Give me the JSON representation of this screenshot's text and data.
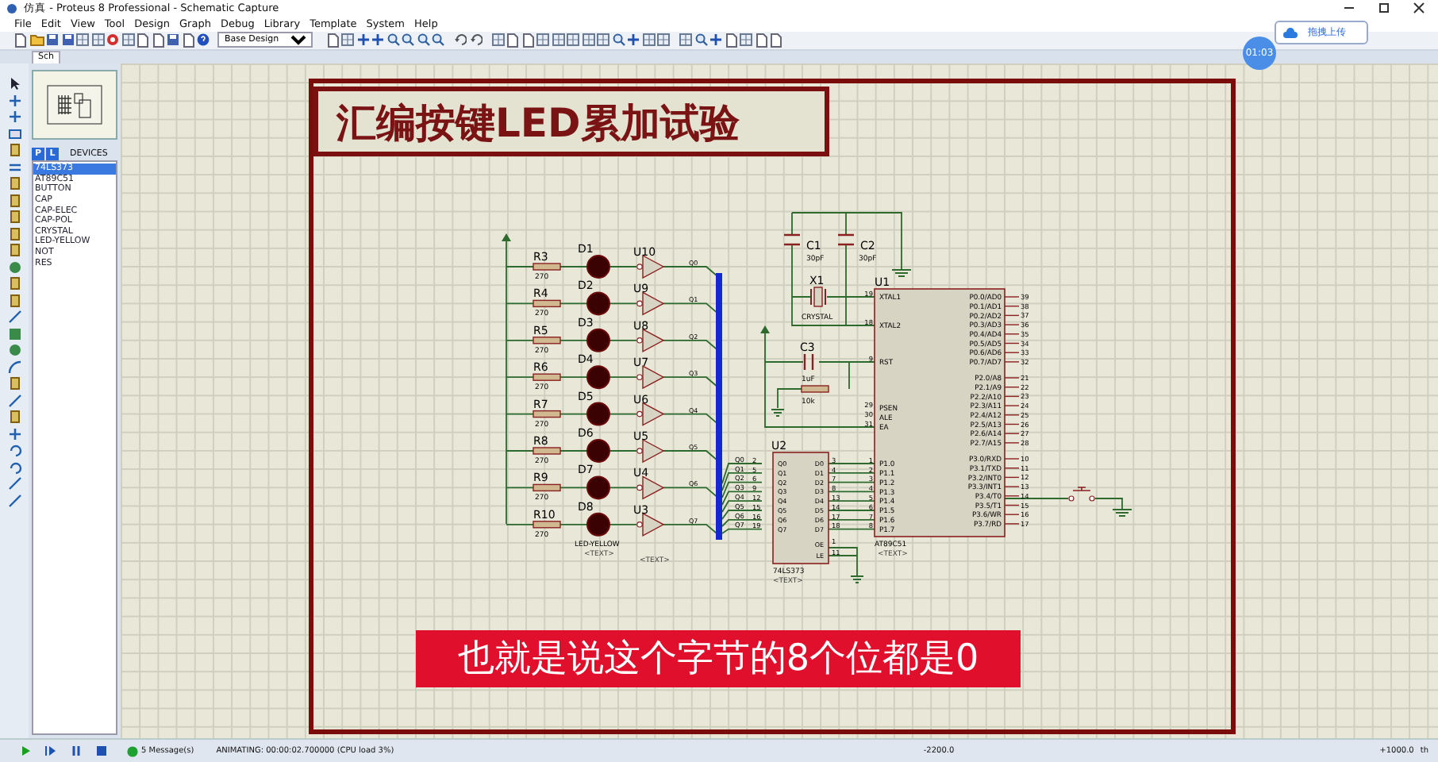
{
  "window": {
    "title": "仿真 - Proteus 8 Professional - Schematic Capture"
  },
  "menu": [
    "File",
    "Edit",
    "View",
    "Tool",
    "Design",
    "Graph",
    "Debug",
    "Library",
    "Template",
    "System",
    "Help"
  ],
  "toolbar": {
    "variant": "Base Design"
  },
  "tabs": [
    {
      "label": "Sch",
      "selected": true
    }
  ],
  "devices_panel": {
    "pick_button": "P",
    "library_button": "L",
    "title": "DEVICES"
  },
  "devices": [
    {
      "label": "74LS373",
      "selected": true
    },
    {
      "label": "AT89C51",
      "selected": false
    },
    {
      "label": "BUTTON",
      "selected": false
    },
    {
      "label": "CAP",
      "selected": false
    },
    {
      "label": "CAP-ELEC",
      "selected": false
    },
    {
      "label": "CAP-POL",
      "selected": false
    },
    {
      "label": "CRYSTAL",
      "selected": false
    },
    {
      "label": "LED-YELLOW",
      "selected": false
    },
    {
      "label": "NOT",
      "selected": false
    },
    {
      "label": "RES",
      "selected": false
    }
  ],
  "schematic": {
    "title": "汇编按键LED累加试验",
    "rows": [
      {
        "resistor": "R3",
        "value": "270",
        "led": "D1",
        "gate": "U10",
        "net": "Q0"
      },
      {
        "resistor": "R4",
        "value": "270",
        "led": "D2",
        "gate": "U9",
        "net": "Q1"
      },
      {
        "resistor": "R5",
        "value": "270",
        "led": "D3",
        "gate": "U8",
        "net": "Q2"
      },
      {
        "resistor": "R6",
        "value": "270",
        "led": "D4",
        "gate": "U7",
        "net": "Q3"
      },
      {
        "resistor": "R7",
        "value": "270",
        "led": "D5",
        "gate": "U6",
        "net": "Q4"
      },
      {
        "resistor": "R8",
        "value": "270",
        "led": "D6",
        "gate": "U5",
        "net": "Q5"
      },
      {
        "resistor": "R9",
        "value": "270",
        "led": "D7",
        "gate": "U4",
        "net": "Q6"
      },
      {
        "resistor": "R10",
        "value": "270",
        "led": "D8",
        "gate": "U3",
        "net": "Q7"
      }
    ],
    "led_part": "LED-YELLOW",
    "led_text": "<TEXT>",
    "gate_text": "<TEXT>",
    "bus_labels": [
      "Q0",
      "Q1",
      "Q2",
      "Q3",
      "Q4",
      "Q5",
      "Q6",
      "Q7"
    ],
    "u2": {
      "ref": "U2",
      "part": "74LS373",
      "text": "<TEXT>",
      "left_pins": [
        {
          "name": "Q0",
          "number": "2"
        },
        {
          "name": "Q1",
          "number": "5"
        },
        {
          "name": "Q2",
          "number": "6"
        },
        {
          "name": "Q3",
          "number": "9"
        },
        {
          "name": "Q4",
          "number": "12"
        },
        {
          "name": "Q5",
          "number": "15"
        },
        {
          "name": "Q6",
          "number": "16"
        },
        {
          "name": "Q7",
          "number": "19"
        }
      ],
      "right_pins": [
        {
          "name": "D0",
          "number": "3"
        },
        {
          "name": "D1",
          "number": "4"
        },
        {
          "name": "D2",
          "number": "7"
        },
        {
          "name": "D3",
          "number": "8"
        },
        {
          "name": "D4",
          "number": "13"
        },
        {
          "name": "D5",
          "number": "14"
        },
        {
          "name": "D6",
          "number": "17"
        },
        {
          "name": "D7",
          "number": "18"
        },
        {
          "name": "OE",
          "number": "1"
        },
        {
          "name": "LE",
          "number": "11"
        }
      ]
    },
    "u1": {
      "ref": "U1",
      "part": "AT89C51",
      "text": "<TEXT>",
      "left_pins": [
        {
          "name": "XTAL1",
          "number": "19"
        },
        {
          "name": "XTAL2",
          "number": "18"
        },
        {
          "name": "RST",
          "number": "9"
        },
        {
          "name": "PSEN",
          "number": "29"
        },
        {
          "name": "ALE",
          "number": "30"
        },
        {
          "name": "EA",
          "number": "31"
        },
        {
          "name": "P1.0",
          "number": "1"
        },
        {
          "name": "P1.1",
          "number": "2"
        },
        {
          "name": "P1.2",
          "number": "3"
        },
        {
          "name": "P1.3",
          "number": "4"
        },
        {
          "name": "P1.4",
          "number": "5"
        },
        {
          "name": "P1.5",
          "number": "6"
        },
        {
          "name": "P1.6",
          "number": "7"
        },
        {
          "name": "P1.7",
          "number": "8"
        }
      ],
      "right_pins": [
        {
          "name": "P0.0/AD0",
          "number": "39"
        },
        {
          "name": "P0.1/AD1",
          "number": "38"
        },
        {
          "name": "P0.2/AD2",
          "number": "37"
        },
        {
          "name": "P0.3/AD3",
          "number": "36"
        },
        {
          "name": "P0.4/AD4",
          "number": "35"
        },
        {
          "name": "P0.5/AD5",
          "number": "34"
        },
        {
          "name": "P0.6/AD6",
          "number": "33"
        },
        {
          "name": "P0.7/AD7",
          "number": "32"
        },
        {
          "name": "P2.0/A8",
          "number": "21"
        },
        {
          "name": "P2.1/A9",
          "number": "22"
        },
        {
          "name": "P2.2/A10",
          "number": "23"
        },
        {
          "name": "P2.3/A11",
          "number": "24"
        },
        {
          "name": "P2.4/A12",
          "number": "25"
        },
        {
          "name": "P2.5/A13",
          "number": "26"
        },
        {
          "name": "P2.6/A14",
          "number": "27"
        },
        {
          "name": "P2.7/A15",
          "number": "28"
        },
        {
          "name": "P3.0/RXD",
          "number": "10"
        },
        {
          "name": "P3.1/TXD",
          "number": "11"
        },
        {
          "name": "P3.2/INT0",
          "number": "12"
        },
        {
          "name": "P3.3/INT1",
          "number": "13"
        },
        {
          "name": "P3.4/T0",
          "number": "14"
        },
        {
          "name": "P3.5/T1",
          "number": "15"
        },
        {
          "name": "P3.6/WR",
          "number": "16"
        },
        {
          "name": "P3.7/RD",
          "number": "17"
        }
      ]
    },
    "c1": {
      "ref": "C1",
      "value": "30pF"
    },
    "c2": {
      "ref": "C2",
      "value": "30pF"
    },
    "x1": {
      "ref": "X1",
      "part": "CRYSTAL"
    },
    "c3": {
      "ref": "C3",
      "value": "1uF"
    },
    "r_reset": {
      "value": "10k"
    }
  },
  "subtitle": "也就是说这个字节的8个位都是0",
  "recorder": {
    "timer": "01:03",
    "upload_button": "拖拽上传"
  },
  "status_bar": {
    "messages": "5 Message(s)",
    "animation": "ANIMATING: 00:00:02.700000 (CPU load 3%)",
    "x_coord": "-2200.0",
    "y_coord": "+1000.0",
    "unit": "th"
  }
}
